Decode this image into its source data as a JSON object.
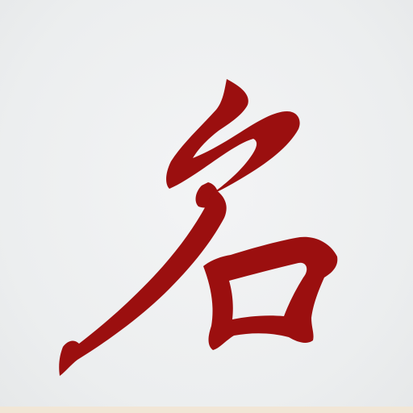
{
  "artwork": {
    "character": "名",
    "ink_color": "#9b0f0f",
    "paper_color": "#eef0f1",
    "strip_color": "#f1e6d6"
  }
}
